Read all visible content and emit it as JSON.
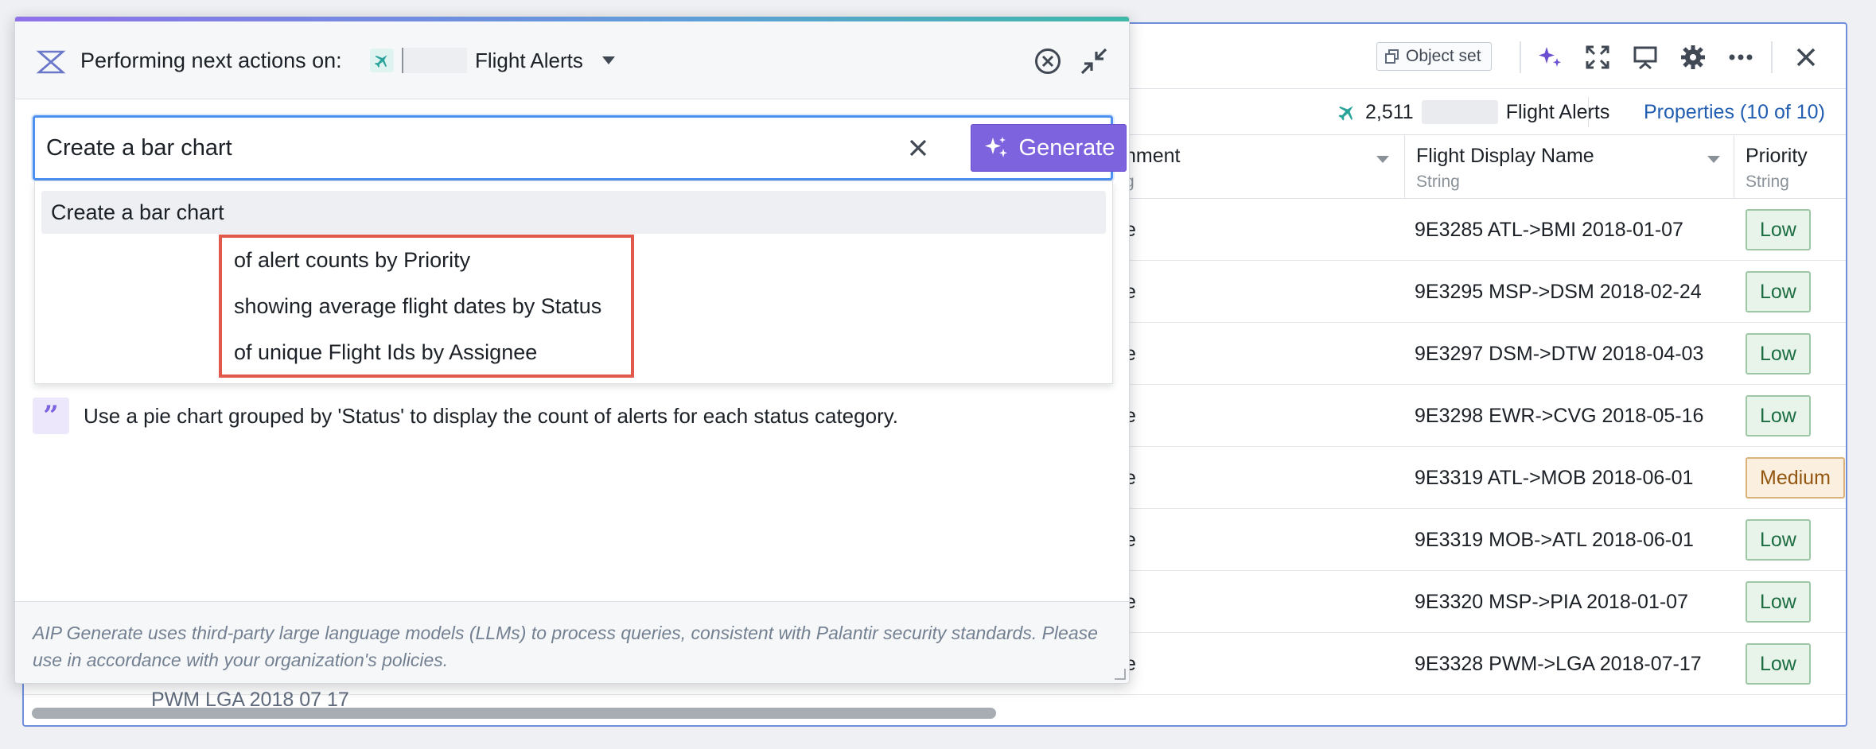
{
  "toolbar": {
    "object_set_label": "Object set"
  },
  "subbar": {
    "count": "2,511",
    "object_type": "Flight Alerts",
    "properties_link": "Properties (10 of 10)"
  },
  "table": {
    "columns": [
      {
        "title": "nment",
        "type": "g"
      },
      {
        "title": "Flight Display Name",
        "type": "String"
      },
      {
        "title": "Priority",
        "type": "String"
      }
    ],
    "rows": [
      {
        "e": "e",
        "name": "9E3285 ATL->BMI 2018-01-07",
        "priority": "Low"
      },
      {
        "e": "e",
        "name": "9E3295 MSP->DSM 2018-02-24",
        "priority": "Low"
      },
      {
        "e": "e",
        "name": "9E3297 DSM->DTW 2018-04-03",
        "priority": "Low"
      },
      {
        "e": "e",
        "name": "9E3298 EWR->CVG 2018-05-16",
        "priority": "Low"
      },
      {
        "e": "e",
        "name": "9E3319 ATL->MOB 2018-06-01",
        "priority": "Medium"
      },
      {
        "e": "e",
        "name": "9E3319 MOB->ATL 2018-06-01",
        "priority": "Low"
      },
      {
        "e": "e",
        "name": "9E3320 MSP->PIA 2018-01-07",
        "priority": "Low"
      },
      {
        "e": "e",
        "name": "9E3328 PWM->LGA 2018-07-17",
        "priority": "Low"
      }
    ],
    "partial_text_below": "PWM  LGA 2018 07 17"
  },
  "dialog": {
    "header_label": "Performing next actions on:",
    "target_name": "Flight Alerts",
    "prompt_value": "Create a bar chart",
    "generate_label": "Generate",
    "selected_suggestion": "Create a bar chart",
    "completions": [
      "of alert counts by Priority",
      "showing average flight dates by Status",
      "of unique Flight Ids by Assignee"
    ],
    "example_prompt": "Use a pie chart grouped by 'Status' to display the count of alerts for each status category.",
    "footer_text": "AIP Generate uses third-party large language models (LLMs) to process queries, consistent with Palantir security standards. Please use in accordance with your organization's policies."
  },
  "colors": {
    "accent_purple": "#7e63de",
    "focus_blue": "#4c90f0",
    "highlight_red": "#e1594c",
    "low_green": "#1c6e42",
    "medium_orange": "#935610"
  },
  "icons": [
    "aip-logo-icon",
    "plane-icon",
    "close-circle-icon",
    "minimize-icon",
    "clear-icon",
    "sparkle-icon",
    "quote-icon",
    "object-set-icon",
    "maximize-icon",
    "present-icon",
    "gear-icon",
    "more-icon",
    "close-icon"
  ]
}
